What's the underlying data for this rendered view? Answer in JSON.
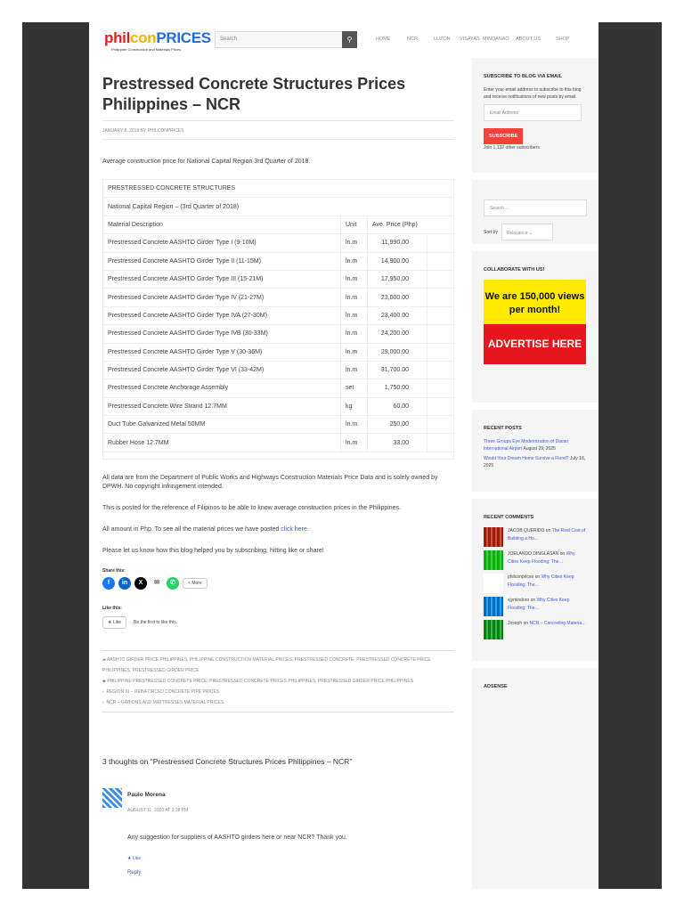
{
  "header": {
    "logo_a": "phil",
    "logo_b": "con",
    "logo_c": "PRICES",
    "tagline": "Philippine Construction and Materials Prices",
    "search_placeholder": "Search",
    "nav": [
      "HOME",
      "NCR",
      "LUZON",
      "VISAYAS",
      "MINDANAO",
      "ABOUT US",
      "SHOP"
    ]
  },
  "post": {
    "title": "Prestressed Concrete Structures Prices Philippines – NCR",
    "meta": "JANUARY 8, 2019 BY PHILCONPRICES",
    "intro": "Average construction price for National Capital Region 3rd Quarter of 2018.",
    "table": {
      "title": "PRESTRESSED CONCRETE STRUCTURES",
      "subtitle": "National Capital Region – (3rd Quarter of 2018)",
      "headers": [
        "Material Description",
        "Unit",
        "Ave. Price (Php)"
      ],
      "rows": [
        [
          "Prestressed Concrete AASHTO Girder Type I (9-10M)",
          "ln.m",
          "11,990.00"
        ],
        [
          "Prestressed Concrete AASHTO Girder Type II (11-15M)",
          "ln.m",
          "14,900.00"
        ],
        [
          "Prestressed Concrete AASHTO Girder Type III (15-21M)",
          "ln.m",
          "17,950.00"
        ],
        [
          "Prestressed Concrete AASHTO Girder Type IV (21-27M)",
          "ln.m",
          "23,000.00"
        ],
        [
          "Prestressed Concrete AASHTO Girder Type IVA (27-30M)",
          "ln.m",
          "23,400.00"
        ],
        [
          "Prestressed Concrete AASHTO Girder Type IVB (30-33M)",
          "ln.m",
          "24,200.00"
        ],
        [
          "Prestressed Concrete AASHTO Girder Type V (30-36M)",
          "ln.m",
          "29,000.00"
        ],
        [
          "Prestressed Concrete AASHTO Girder Type VI (33-42M)",
          "ln.m",
          "31,700.00"
        ],
        [
          "Prestressed Concrete Anchorage Assembly",
          "set",
          "1,750.00"
        ],
        [
          "Prestressed Concrete Wire Strand 12.7MM",
          "kg",
          "60.00"
        ],
        [
          "Duct Tube Galvanized Metal 50MM",
          "ln.m",
          "250.00"
        ],
        [
          "Rubber Hose 12.7MM",
          "ln.m",
          "33.00"
        ]
      ]
    },
    "p1": "All data are from the Department of Public Works and Highways Construction Materials Price Data and is solely owned by DPWH. No copyright infringement intended.",
    "p2": "This is posted for the reference of Filipinos to be able to know average construction prices in the Philippines.",
    "p3": "All amount in Php. To see all the material prices we have posted ",
    "p3_link": "click here.",
    "p4": "Please let us know how this blog helped you by subscribing, hitting like or share!",
    "share_label": "Share this:",
    "more": "More",
    "like_label": "Like this:",
    "like_btn": "Like",
    "like_first": "Be the first to like this.",
    "categories": "AASHTO GIRDER PRICE PHILIPPINES, PHILIPPINE CONSTRUCTION MATERIAL PRICES, PRESTRESSED CONCRETE, PRESTRESSED CONCRETE PRICE PHILIPPINES, PRESTRESSED GIRDER PRICE",
    "tags": "PHILIPPINE PRESTRESSED CONCRETE PRICE, PRESTRESSED CONCRETE PRICES PHILIPPINES, PRESTRESSED GIRDER PRICE PHILIPPINES",
    "prev": "REGION XI – REINFORCED CONCRETE PIPE PRICES",
    "next": "NCR – GABIONS AND MATTRESSES MATERIAL PRICES"
  },
  "comments": {
    "heading": "3 thoughts on “Prestressed Concrete Structures Prices Philippines – NCR”",
    "author": "Paulo Morena",
    "date": "AUGUST 11, 2020 AT 3:28 PM",
    "text": "Any suggestion for suppliers of AASHTO girders here or near NCR? Thank you.",
    "like": "Like",
    "reply": "Reply"
  },
  "sidebar": {
    "subscribe_title": "SUBSCRIBE TO BLOG VIA EMAIL",
    "subscribe_text": "Enter your email address to subscribe to this blog and receive notifications of new posts by email.",
    "email_placeholder": "Email Address",
    "subscribe_btn": "SUBSCRIBE",
    "subscribers": "Join 1,132 other subscribers",
    "search_placeholder": "Search …",
    "sort_label": "Sort by",
    "sort_value": "Relevance",
    "collab_title": "COLLABORATE WITH US!",
    "ad_line1": "We are 150,000 views per month!",
    "ad_line2": "ADVERTISE HERE",
    "recent_posts_title": "RECENT POSTS",
    "recent_posts": [
      {
        "title": "Three Groups Eye Modernization of Davao International Airport",
        "date": "August 29, 2025"
      },
      {
        "title": "Would Your Dream Home Survive a Flood?",
        "date": "July 18, 2025"
      }
    ],
    "recent_comments_title": "RECENT COMMENTS",
    "recent_comments": [
      {
        "author": "JACOB QUERIDO",
        "on": " on ",
        "post": "The Real Cost of Building a Ho…",
        "color": "#c8553a"
      },
      {
        "author": "JOELANDO DINGLASAN",
        "on": " on ",
        "post": "Why Cities Keep Flooding: The…",
        "color": "#3ad33a"
      },
      {
        "author": "philconprices",
        "on": " on ",
        "post": "Why Cities Keep Flooding: The…",
        "color": "#ffffff"
      },
      {
        "author": "sjymindoro",
        "on": " on ",
        "post": "Why Cities Keep Flooding: The…",
        "color": "#2aa3e0"
      },
      {
        "author": "Joseph",
        "on": " on ",
        "post": "NCR – Concreting Materia…",
        "color": "#3ab54a"
      }
    ],
    "adsense_title": "ADSENSE"
  }
}
